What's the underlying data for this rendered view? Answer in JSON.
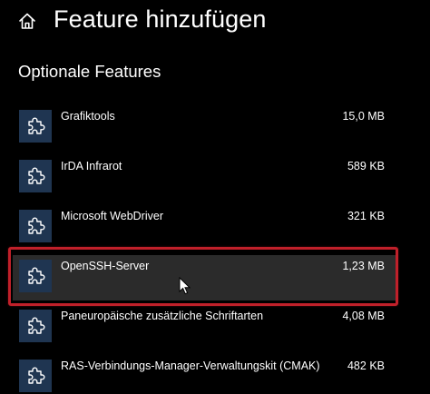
{
  "header": {
    "title": "Feature hinzufügen",
    "home_icon": "home-icon"
  },
  "section": {
    "title": "Optionale Features"
  },
  "features": [
    {
      "name": "Grafiktools",
      "size": "15,0 MB",
      "icon": "puzzle-icon",
      "selected": false
    },
    {
      "name": "IrDA Infrarot",
      "size": "589 KB",
      "icon": "puzzle-icon",
      "selected": false
    },
    {
      "name": "Microsoft WebDriver",
      "size": "321 KB",
      "icon": "puzzle-icon",
      "selected": false
    },
    {
      "name": "OpenSSH-Server",
      "size": "1,23 MB",
      "icon": "puzzle-icon",
      "selected": true
    },
    {
      "name": "Paneuropäische zusätzliche Schriftarten",
      "size": "4,08 MB",
      "icon": "puzzle-icon",
      "selected": false
    },
    {
      "name": "RAS-Verbindungs-Manager-Verwaltungskit (CMAK)",
      "size": "482 KB",
      "icon": "puzzle-icon",
      "selected": false
    }
  ],
  "colors": {
    "background": "#000000",
    "icon_tile": "#1f3551",
    "selected_row": "#2b2b2b",
    "highlight_border": "#c0202a"
  }
}
